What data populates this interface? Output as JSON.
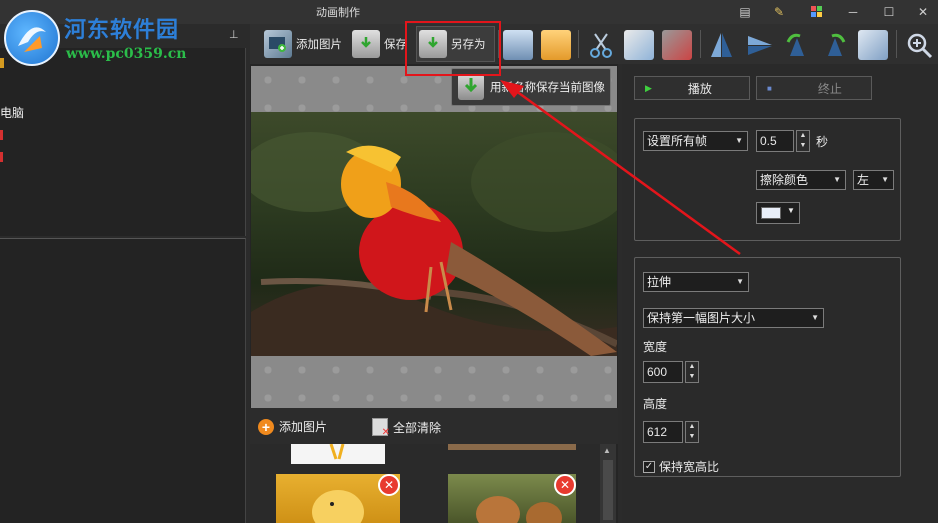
{
  "window": {
    "title": "动画制作"
  },
  "watermark": {
    "site_name": "河东软件园",
    "url": "www.pc0359.cn"
  },
  "toolbar": {
    "add_image_label": "添加图片",
    "save_label": "保存",
    "save_as_label": "另存为"
  },
  "tooltip": {
    "text": "用新名称保存当前图像"
  },
  "left_panel": {
    "pin": "ᵖ",
    "tree_items": [
      "电脑"
    ]
  },
  "image_list": {
    "add_label": "添加图片",
    "clear_label": "全部清除"
  },
  "playback": {
    "play_label": "播放",
    "stop_label": "终止"
  },
  "frame_settings": {
    "frames_select": "设置所有帧",
    "delay_value": "0.5",
    "delay_unit": "秒",
    "disposal_select": "擦除颜色",
    "align_select": "左"
  },
  "size_settings": {
    "mode_select": "拉伸",
    "size_select": "保持第一幅图片大小",
    "width_label": "宽度",
    "width_value": "600",
    "height_label": "高度",
    "height_value": "612",
    "keep_ratio_label": "保持宽高比",
    "keep_ratio_checked": true
  },
  "colors": {
    "annotation_red": "#e3151b",
    "logo_blue": "#2d7fd8",
    "logo_green": "#2bbd4a"
  }
}
